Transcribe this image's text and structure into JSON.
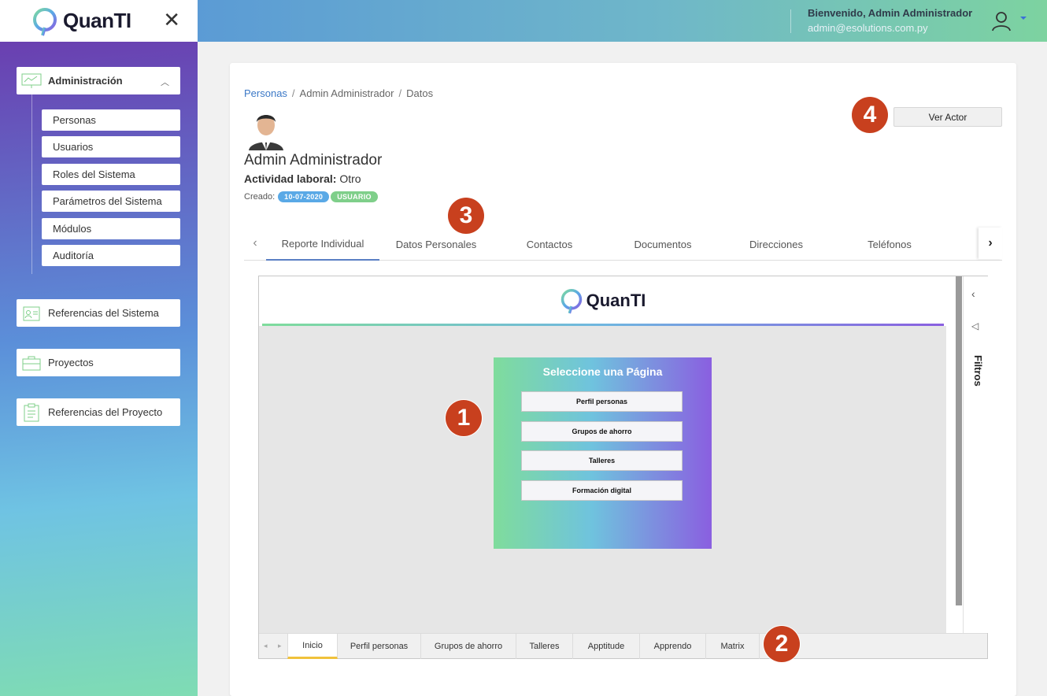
{
  "brand": {
    "name": "QuanTI",
    "close_icon": "close-icon"
  },
  "header": {
    "welcome": "Bienvenido, Admin Administrador",
    "email": "admin@esolutions.com.py",
    "user_icon": "user-icon"
  },
  "sidebar": {
    "admin": {
      "label": "Administración",
      "icon": "presentation-icon"
    },
    "admin_items": [
      {
        "label": "Personas"
      },
      {
        "label": "Usuarios"
      },
      {
        "label": "Roles del Sistema"
      },
      {
        "label": "Parámetros del Sistema"
      },
      {
        "label": "Módulos"
      },
      {
        "label": "Auditoría"
      }
    ],
    "refs_sistema": {
      "label": "Referencias del Sistema",
      "icon": "id-card-icon"
    },
    "proyectos": {
      "label": "Proyectos",
      "icon": "briefcase-icon"
    },
    "refs_proyecto": {
      "label": "Referencias del Proyecto",
      "icon": "clipboard-icon"
    }
  },
  "breadcrumb": {
    "root": "Personas",
    "sep": "/",
    "middle": "Admin Administrador",
    "current": "Datos"
  },
  "person": {
    "name": "Admin Administrador",
    "actividad_label": "Actividad laboral:",
    "actividad_value": "Otro",
    "creado_label": "Creado:",
    "date_badge": "10-07-2020",
    "role_badge": "USUARIO"
  },
  "ver_actor": "Ver Actor",
  "tabs": [
    {
      "label": "Reporte Individual",
      "active": true
    },
    {
      "label": "Datos Personales"
    },
    {
      "label": "Contactos"
    },
    {
      "label": "Documentos"
    },
    {
      "label": "Direcciones"
    },
    {
      "label": "Teléfonos"
    }
  ],
  "report": {
    "logo": "QuanTI",
    "filters_label": "Filtros",
    "page_select_title": "Seleccione una Página",
    "page_buttons": [
      "Perfil personas",
      "Grupos de ahorro",
      "Talleres",
      "Formación digital"
    ],
    "bottom_tabs": [
      {
        "label": "Inicio",
        "active": true
      },
      {
        "label": "Perfil personas"
      },
      {
        "label": "Grupos de ahorro"
      },
      {
        "label": "Talleres"
      },
      {
        "label": "Apptitude"
      },
      {
        "label": "Apprendo"
      },
      {
        "label": "Matrix"
      }
    ]
  },
  "callouts": [
    "1",
    "2",
    "3",
    "4"
  ],
  "colors": {
    "accent_link": "#3b78c6",
    "callout": "#c8401e",
    "badge_date": "#5aa9e6",
    "badge_role": "#7fcf8a",
    "active_report_tab": "#f0c23b"
  }
}
